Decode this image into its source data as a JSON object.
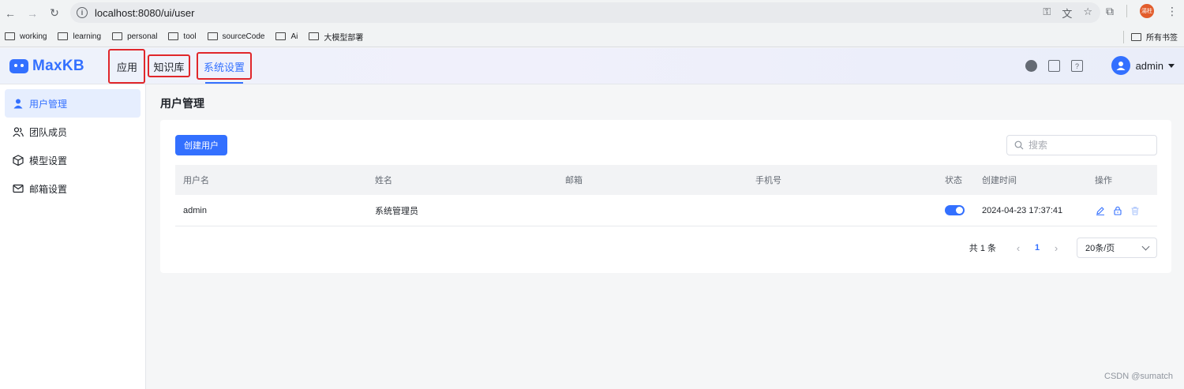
{
  "browser": {
    "url": "localhost:8080/ui/user",
    "profile_label": "湯柱",
    "bookmarks": [
      "working",
      "learning",
      "personal",
      "tool",
      "sourceCode",
      "Ai",
      "大模型部署"
    ],
    "all_bookmarks": "所有书签"
  },
  "app": {
    "logo": "MaxKB",
    "nav_tabs": [
      {
        "label": "应用",
        "active": false
      },
      {
        "label": "知识库",
        "active": false
      },
      {
        "label": "系统设置",
        "active": true
      }
    ],
    "user": "admin",
    "accent_color": "#3370ff",
    "highlight_color": "#e0272b"
  },
  "sidebar": {
    "items": [
      {
        "label": "用户管理",
        "icon": "user-icon",
        "active": true
      },
      {
        "label": "团队成员",
        "icon": "team-icon",
        "active": false
      },
      {
        "label": "模型设置",
        "icon": "cube-icon",
        "active": false
      },
      {
        "label": "邮箱设置",
        "icon": "mail-icon",
        "active": false
      }
    ]
  },
  "main": {
    "title": "用户管理",
    "create_button": "创建用户",
    "search_placeholder": "搜索",
    "table": {
      "headers": [
        "用户名",
        "姓名",
        "邮箱",
        "手机号",
        "状态",
        "创建时间",
        "操作"
      ],
      "rows": [
        {
          "username": "admin",
          "name": "系统管理员",
          "email": "",
          "phone": "",
          "status": true,
          "created": "2024-04-23 17:37:41"
        }
      ]
    },
    "pagination": {
      "total": "共 1 条",
      "current_page": "1",
      "page_size": "20条/页"
    }
  },
  "watermark": "CSDN @sumatch"
}
